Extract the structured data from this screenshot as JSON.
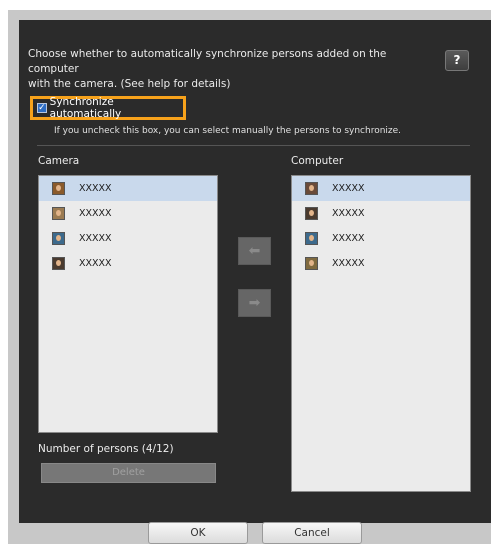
{
  "intro": {
    "line1": "Choose whether to automatically synchronize persons added on the computer",
    "line2": "with the camera. (See help for details)"
  },
  "help_label": "?",
  "sync": {
    "checked": true,
    "label": "Synchronize automatically",
    "note": "If you uncheck this box, you can select manually the persons to synchronize."
  },
  "camera": {
    "title": "Camera",
    "items": [
      {
        "label": "XXXXX",
        "selected": true,
        "icon": "person-photo-icon"
      },
      {
        "label": "XXXXX",
        "selected": false,
        "icon": "person-photo-icon"
      },
      {
        "label": "XXXXX",
        "selected": false,
        "icon": "person-photo-icon"
      },
      {
        "label": "XXXXX",
        "selected": false,
        "icon": "person-photo-icon"
      }
    ],
    "count_label": "Number of persons (4/12)",
    "delete_label": "Delete"
  },
  "computer": {
    "title": "Computer",
    "items": [
      {
        "label": "XXXXX",
        "selected": true,
        "icon": "person-photo-icon"
      },
      {
        "label": "XXXXX",
        "selected": false,
        "icon": "person-photo-icon"
      },
      {
        "label": "XXXXX",
        "selected": false,
        "icon": "person-photo-icon"
      },
      {
        "label": "XXXXX",
        "selected": false,
        "icon": "person-photo-icon"
      }
    ]
  },
  "transfer": {
    "left_icon": "arrow-left-icon",
    "right_icon": "arrow-right-icon"
  },
  "footer": {
    "ok_label": "OK",
    "cancel_label": "Cancel"
  },
  "colors": {
    "accent_highlight": "#f7a21b",
    "panel_bg": "#2b2b2b",
    "selection": "#c9d9ec"
  }
}
